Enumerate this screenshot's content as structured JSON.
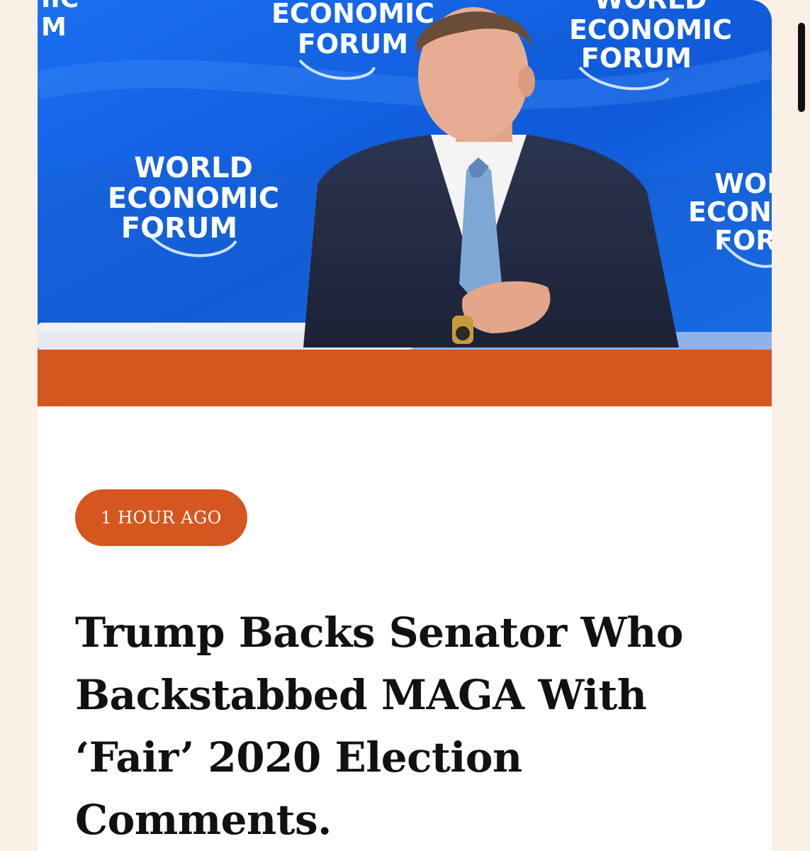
{
  "colors": {
    "page_bg": "#faf0e6",
    "card_bg": "#ffffff",
    "accent": "#d6561f",
    "banner_blue": "#1466e0",
    "headline": "#111111"
  },
  "hero": {
    "image_description_icon": "photo-icon",
    "banner_text": {
      "line1": "WORLD",
      "line2": "ECONOMIC",
      "line3": "FORUM"
    },
    "partial_text_left": {
      "line1": "IIC",
      "line2": "M"
    },
    "partial_text_right": {
      "line1": "WOR",
      "line2": "ECON",
      "line3": "FOR"
    }
  },
  "article": {
    "time_badge": "1 HOUR AGO",
    "headline_lines": [
      "Trump Backs Senator Who",
      "Backstabbed MAGA With",
      "‘Fair’ 2020 Election",
      "Comments."
    ]
  }
}
